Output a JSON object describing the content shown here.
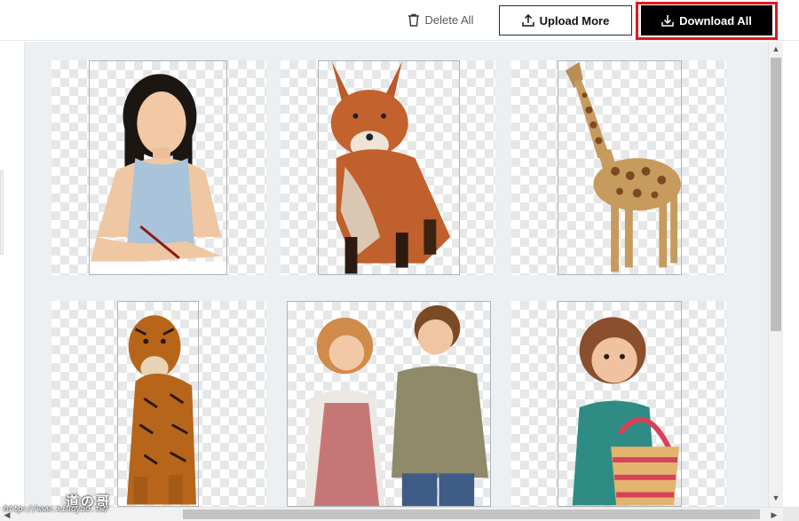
{
  "toolbar": {
    "delete_all_label": "Delete All",
    "upload_more_label": "Upload More",
    "download_all_label": "Download All",
    "delete_icon": "trash-icon",
    "upload_icon": "upload-icon",
    "download_icon": "download-icon"
  },
  "annotation": {
    "highlight_color": "#e0171e",
    "arrow_color": "#e0171e"
  },
  "gallery": {
    "images": [
      {
        "subject": "woman"
      },
      {
        "subject": "fox"
      },
      {
        "subject": "giraffe"
      },
      {
        "subject": "tiger"
      },
      {
        "subject": "children"
      },
      {
        "subject": "girl"
      }
    ]
  },
  "watermark": {
    "logo_text": "道の哥",
    "url": "http://www.xiaoyao.tw/"
  },
  "colors": {
    "gallery_background": "#edf0f2",
    "button_dark": "#000000",
    "checker": "#e6e7e8"
  }
}
